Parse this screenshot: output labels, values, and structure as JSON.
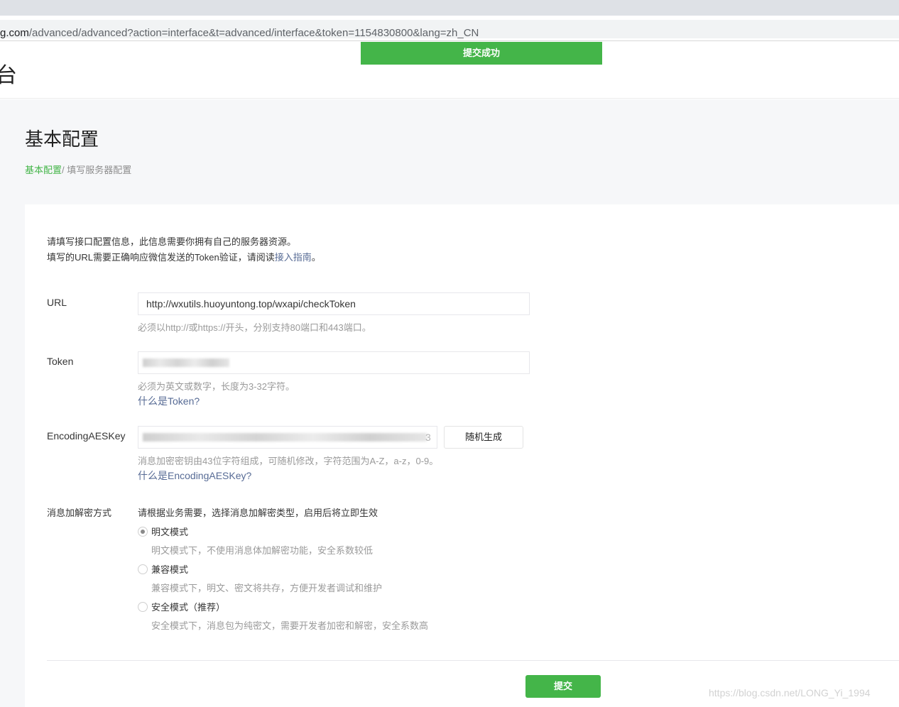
{
  "browser": {
    "url_host": "g.com",
    "url_path": "/advanced/advanced?action=interface&t=advanced/interface&token=1154830800&lang=zh_CN"
  },
  "header": {
    "logo_fragment": "台",
    "toast": "提交成功"
  },
  "page": {
    "title": "基本配置",
    "breadcrumb": {
      "link": "基本配置",
      "separator": "/",
      "current": " 填写服务器配置"
    }
  },
  "intro": {
    "line1": "请填写接口配置信息，此信息需要你拥有自己的服务器资源。",
    "line2_prefix": "填写的URL需要正确响应微信发送的Token验证，请阅读",
    "line2_link": "接入指南",
    "line2_suffix": "。"
  },
  "form": {
    "url": {
      "label": "URL",
      "value": "http://wxutils.huoyuntong.top/wxapi/checkToken",
      "hint": "必须以http://或https://开头，分别支持80端口和443端口。"
    },
    "token": {
      "label": "Token",
      "hint": "必须为英文或数字，长度为3-32字符。",
      "help_link": "什么是Token?"
    },
    "aeskey": {
      "label": "EncodingAESKey",
      "tail": "3",
      "generate_button": "随机生成",
      "hint": "消息加密密钥由43位字符组成，可随机修改，字符范围为A-Z，a-z，0-9。",
      "help_link": "什么是EncodingAESKey?"
    },
    "encryption": {
      "label": "消息加解密方式",
      "description": "请根据业务需要，选择消息加解密类型，启用后将立即生效",
      "options": [
        {
          "label": "明文模式",
          "desc": "明文模式下，不使用消息体加解密功能，安全系数较低",
          "checked": true
        },
        {
          "label": "兼容模式",
          "desc": "兼容模式下，明文、密文将共存，方便开发者调试和维护",
          "checked": false
        },
        {
          "label": "安全模式（推荐）",
          "desc": "安全模式下，消息包为纯密文，需要开发者加密和解密，安全系数高",
          "checked": false
        }
      ]
    }
  },
  "submit_label": "提交",
  "watermark": "https://blog.csdn.net/LONG_Yi_1994",
  "colors": {
    "primary_green": "#44b549",
    "link_blue": "#576b95"
  }
}
